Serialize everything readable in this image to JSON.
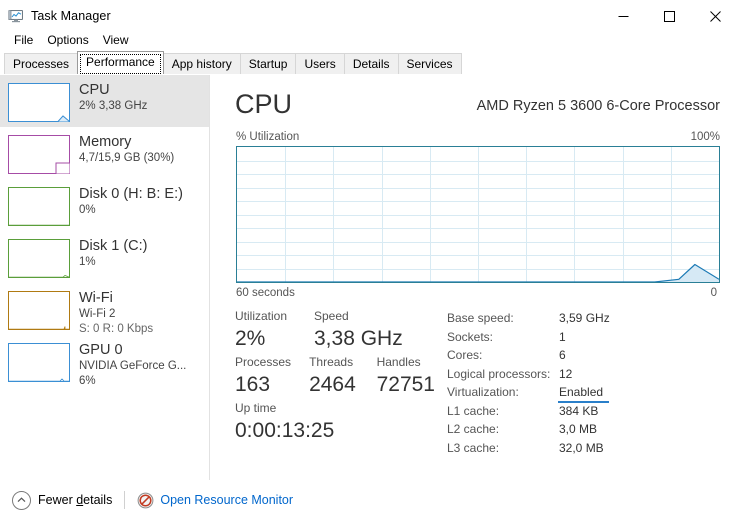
{
  "window": {
    "title": "Task Manager",
    "icon": "task-manager-icon",
    "controls": {
      "minimize": "—",
      "maximize": "☐",
      "close": "✕"
    }
  },
  "menubar": {
    "items": [
      {
        "label": "File"
      },
      {
        "label": "Options"
      },
      {
        "label": "View"
      }
    ]
  },
  "tabs": [
    {
      "label": "Processes",
      "active": false
    },
    {
      "label": "Performance",
      "active": true
    },
    {
      "label": "App history",
      "active": false
    },
    {
      "label": "Startup",
      "active": false
    },
    {
      "label": "Users",
      "active": false
    },
    {
      "label": "Details",
      "active": false
    },
    {
      "label": "Services",
      "active": false
    }
  ],
  "sidebar": {
    "items": [
      {
        "name": "CPU",
        "line2": "2%  3,38 GHz",
        "line3": "",
        "color": "#3b8fd4",
        "selected": true
      },
      {
        "name": "Memory",
        "line2": "4,7/15,9 GB (30%)",
        "line3": "",
        "color": "#a64ca6",
        "selected": false
      },
      {
        "name": "Disk 0 (H: B: E:)",
        "line2": "0%",
        "line3": "",
        "color": "#5a9e3a",
        "selected": false
      },
      {
        "name": "Disk 1 (C:)",
        "line2": "1%",
        "line3": "",
        "color": "#5a9e3a",
        "selected": false
      },
      {
        "name": "Wi-Fi",
        "line2": "Wi-Fi 2",
        "line3": "S: 0 R: 0 Kbps",
        "color": "#b07a12",
        "selected": false
      },
      {
        "name": "GPU 0",
        "line2": "NVIDIA GeForce G...",
        "line3": "6%",
        "color": "#3b8fd4",
        "selected": false
      }
    ]
  },
  "main": {
    "title": "CPU",
    "subtitle": "AMD Ryzen 5 3600 6-Core Processor",
    "graph": {
      "axis_top_left": "% Utilization",
      "axis_top_right": "100%",
      "axis_bottom_left": "60 seconds",
      "axis_bottom_right": "0",
      "line_color": "#1c7ab5",
      "fill_color": "#d6e9f5",
      "border_color": "#2a7f96",
      "grid_color": "#d8eaf3",
      "grid_rows": 10,
      "grid_cols": 10
    },
    "stats": {
      "utilization_label": "Utilization",
      "utilization_value": "2%",
      "speed_label": "Speed",
      "speed_value": "3,38 GHz",
      "processes_label": "Processes",
      "processes_value": "163",
      "threads_label": "Threads",
      "threads_value": "2464",
      "handles_label": "Handles",
      "handles_value": "72751",
      "uptime_label": "Up time",
      "uptime_value": "0:00:13:25"
    },
    "details": [
      {
        "key": "Base speed:",
        "value": "3,59 GHz",
        "underlined": false
      },
      {
        "key": "Sockets:",
        "value": "1",
        "underlined": false
      },
      {
        "key": "Cores:",
        "value": "6",
        "underlined": false
      },
      {
        "key": "Logical processors:",
        "value": "12",
        "underlined": false
      },
      {
        "key": "Virtualization:",
        "value": "Enabled",
        "underlined": true
      },
      {
        "key": "L1 cache:",
        "value": "384 KB",
        "underlined": false
      },
      {
        "key": "L2 cache:",
        "value": "3,0 MB",
        "underlined": false
      },
      {
        "key": "L3 cache:",
        "value": "32,0 MB",
        "underlined": false
      }
    ]
  },
  "footer": {
    "fewer_details_label": "Fewer details",
    "fewer_details_icon": "chevron-up-icon",
    "resource_monitor_label": "Open Resource Monitor",
    "resource_monitor_icon": "resource-monitor-icon"
  },
  "chart_data": {
    "type": "area",
    "title": "CPU % Utilization",
    "xlabel": "60 seconds",
    "ylabel": "% Utilization",
    "ylim": [
      0,
      100
    ],
    "xlim": [
      60,
      0
    ],
    "grid": true,
    "x": [
      60,
      12,
      8,
      5,
      3,
      0
    ],
    "values": [
      0,
      0,
      0,
      2,
      13,
      2
    ]
  }
}
